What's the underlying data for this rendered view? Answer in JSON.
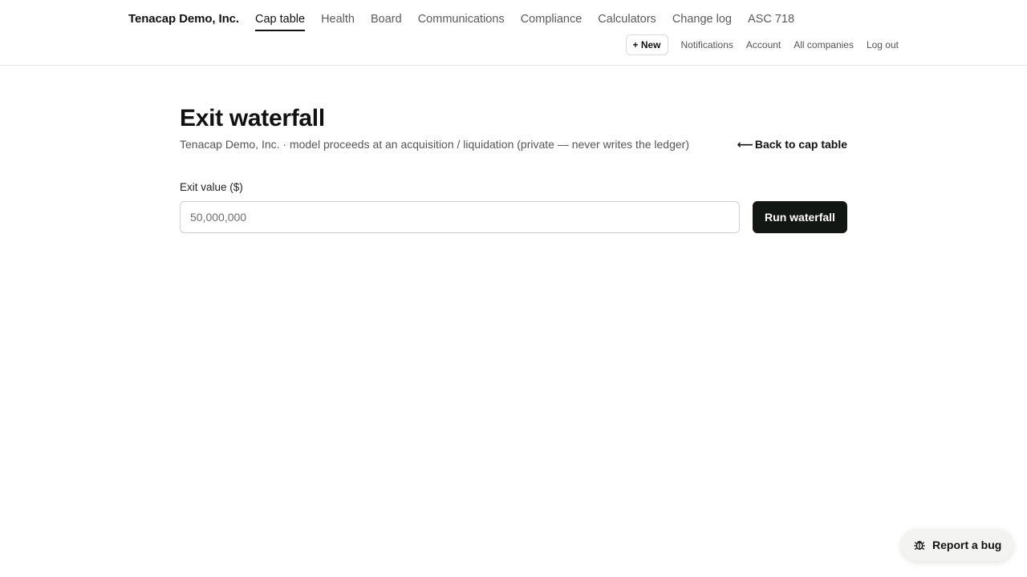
{
  "header": {
    "brand": "Tenacap Demo, Inc.",
    "nav": [
      {
        "label": "Cap table",
        "active": true
      },
      {
        "label": "Health"
      },
      {
        "label": "Board"
      },
      {
        "label": "Communications"
      },
      {
        "label": "Compliance"
      },
      {
        "label": "Calculators"
      },
      {
        "label": "Change log"
      },
      {
        "label": "ASC 718"
      }
    ],
    "new_label": "+ New",
    "links": {
      "notifications": "Notifications",
      "account": "Account",
      "all_companies": "All companies",
      "logout": "Log out"
    }
  },
  "main": {
    "title": "Exit waterfall",
    "subtitle": "Tenacap Demo, Inc. · model proceeds at an acquisition / liquidation (private — never writes the ledger)",
    "back_arrow": "⟵",
    "back_label": "Back to cap table",
    "field_label": "Exit value ($)",
    "input_placeholder": "50,000,000",
    "input_value": "",
    "run_label": "Run waterfall"
  },
  "report_bug": {
    "label": "Report a bug",
    "icon": "bug-icon"
  }
}
